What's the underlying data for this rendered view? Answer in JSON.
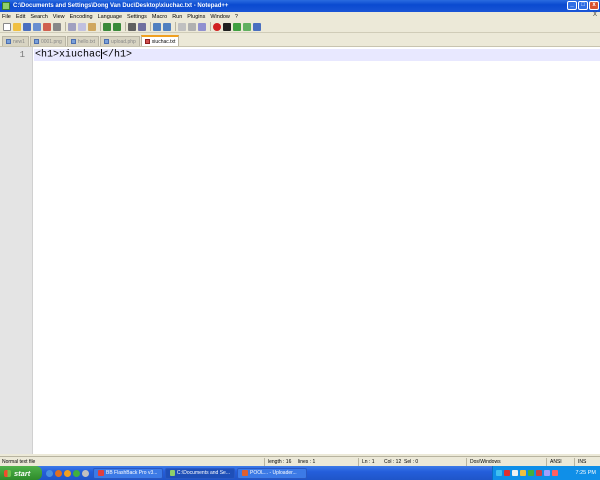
{
  "window": {
    "title": "C:\\Documents and Settings\\Dong Van Duc\\Desktop\\xiuchac.txt - Notepad++",
    "minimize": "_",
    "maximize": "□",
    "close": "x"
  },
  "menu": {
    "items": [
      "File",
      "Edit",
      "Search",
      "View",
      "Encoding",
      "Language",
      "Settings",
      "Macro",
      "Run",
      "Plugins",
      "Window",
      "?"
    ],
    "close": "X"
  },
  "toolbar": {
    "buttons": [
      "new-file-icon",
      "open-file-icon",
      "save-icon",
      "save-all-icon",
      "close-icon",
      "print-icon",
      "cut-icon",
      "copy-icon",
      "paste-icon",
      "undo-icon",
      "redo-icon",
      "find-icon",
      "replace-icon",
      "zoom-in-icon",
      "zoom-out-icon",
      "sync-icon",
      "wrap-icon",
      "indent-icon",
      "record-macro-icon",
      "stop-macro-icon",
      "play-macro-icon",
      "run-macro-icon",
      "save-macro-icon"
    ]
  },
  "tabs": [
    {
      "label": "new1",
      "active": false,
      "icon": "doc-icon"
    },
    {
      "label": "0001.png",
      "active": false,
      "icon": "doc-icon"
    },
    {
      "label": "hello.txt",
      "active": false,
      "icon": "doc-icon"
    },
    {
      "label": "upload.php",
      "active": false,
      "icon": "doc-icon"
    },
    {
      "label": "xiuchac.txt",
      "active": true,
      "icon": "doc-icon"
    }
  ],
  "editor": {
    "line_number": "1",
    "code_before_cursor": "<h1>xiuchac",
    "code_after_cursor": "</h1>"
  },
  "status": {
    "file_type": "Normal text file",
    "length": "length : 16",
    "lines": "lines : 1",
    "ln": "Ln : 1",
    "col": "Col : 12",
    "sel": "Sel : 0",
    "eol": "Dos\\Windows",
    "encoding": "ANSI",
    "mode": "INS"
  },
  "taskbar": {
    "start": "start",
    "tasks": [
      {
        "label": "BB FlashBack Pro v3...",
        "active": false
      },
      {
        "label": "C:\\Documents and Se...",
        "active": true
      },
      {
        "label": "POOL...  - Uploader...",
        "active": false
      }
    ],
    "clock": "7:25 PM"
  },
  "colors": {
    "title_bar": "#0a4ad0",
    "active_tab_accent": "#f0a020",
    "current_line": "#e8e8ff",
    "taskbar": "#245edb",
    "start_button": "#2e8b2a"
  }
}
